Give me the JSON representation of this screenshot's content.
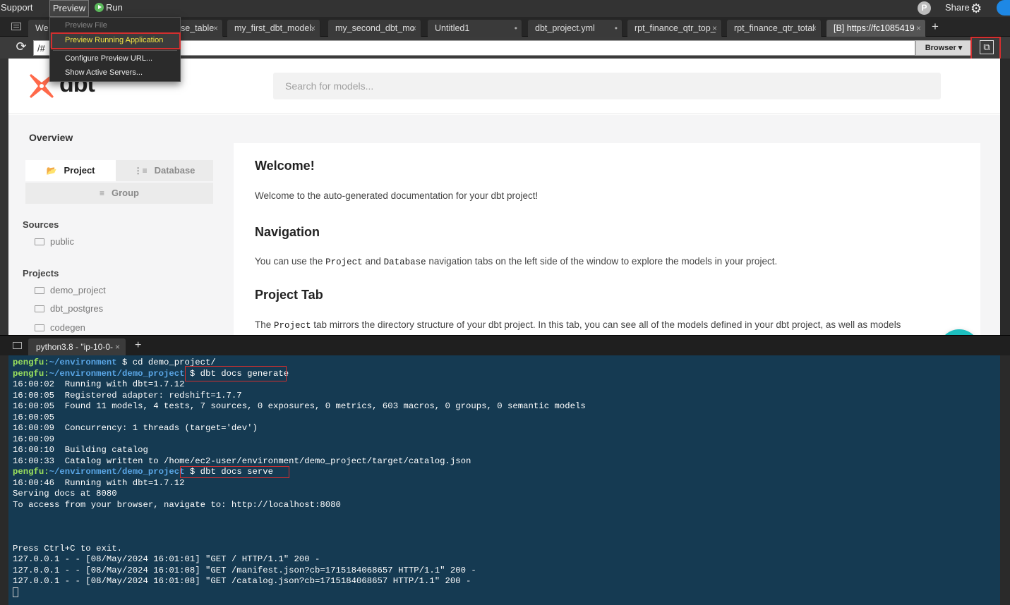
{
  "menubar": {
    "support": "Support",
    "preview": "Preview",
    "run": "Run",
    "avatar_letter": "P",
    "share": "Share"
  },
  "preview_menu": {
    "items": [
      {
        "label": "Preview File",
        "state": "disabled"
      },
      {
        "label": "Preview Running Application",
        "state": "selected"
      },
      {
        "label": "Configure Preview URL...",
        "state": "normal"
      },
      {
        "label": "Show Active Servers...",
        "state": "normal"
      }
    ]
  },
  "editor_tabs": [
    {
      "label": "We",
      "close": ""
    },
    {
      "label": "se_table",
      "close": "×"
    },
    {
      "label": "my_first_dbt_model.",
      "close": "×"
    },
    {
      "label": "my_second_dbt_mo",
      "close": "×"
    },
    {
      "label": "Untitled1",
      "close": "•"
    },
    {
      "label": "dbt_project.yml",
      "close": "•"
    },
    {
      "label": "rpt_finance_qtr_top_",
      "close": "×"
    },
    {
      "label": "rpt_finance_qtr_total",
      "close": "×"
    },
    {
      "label": "[B] https://fc1085419",
      "close": "×"
    }
  ],
  "addressbar": {
    "url_value": "/#",
    "browser_label": "Browser ▾"
  },
  "docs": {
    "logo_text": "dbt",
    "search_placeholder": "Search for models...",
    "overview": "Overview",
    "seg_project": "Project",
    "seg_database": "Database",
    "seg_group": "Group",
    "sources_heading": "Sources",
    "sources": [
      "public"
    ],
    "projects_heading": "Projects",
    "projects": [
      "demo_project",
      "dbt_postgres",
      "codegen"
    ],
    "welcome_title": "Welcome!",
    "welcome_text": "Welcome to the auto-generated documentation for your dbt project!",
    "nav_title": "Navigation",
    "nav_text_1": "You can use the ",
    "nav_code_1": "Project",
    "nav_text_2": " and ",
    "nav_code_2": "Database",
    "nav_text_3": " navigation tabs on the left side of the window to explore the models in your project.",
    "project_tab_title": "Project Tab",
    "pt_text_1": "The ",
    "pt_code": "Project",
    "pt_text_2": " tab mirrors the directory structure of your dbt project. In this tab, you can see all of the models defined in your dbt project, as well as models"
  },
  "terminal": {
    "tab_label": "python3.8 - \"ip-10-0-",
    "tab_close": "×",
    "lines": [
      {
        "user": "pengfu",
        "path": "~/environment",
        "cmd": " $ cd demo_project/"
      },
      {
        "user": "pengfu",
        "path": "~/environment/demo_project",
        "cmd": " $ dbt docs generate"
      },
      {
        "text": "16:00:02  Running with dbt=1.7.12"
      },
      {
        "text": "16:00:05  Registered adapter: redshift=1.7.7"
      },
      {
        "text": "16:00:05  Found 11 models, 4 tests, 7 sources, 0 exposures, 0 metrics, 603 macros, 0 groups, 0 semantic models"
      },
      {
        "text": "16:00:05"
      },
      {
        "text": "16:00:09  Concurrency: 1 threads (target='dev')"
      },
      {
        "text": "16:00:09"
      },
      {
        "text": "16:00:10  Building catalog"
      },
      {
        "text": "16:00:33  Catalog written to /home/ec2-user/environment/demo_project/target/catalog.json"
      },
      {
        "user": "pengfu",
        "path": "~/environment/demo_project",
        "cmd": " $ dbt docs serve"
      },
      {
        "text": "16:00:46  Running with dbt=1.7.12"
      },
      {
        "text": "Serving docs at 8080"
      },
      {
        "text": "To access from your browser, navigate to: http://localhost:8080"
      },
      {
        "text": ""
      },
      {
        "text": ""
      },
      {
        "text": ""
      },
      {
        "text": "Press Ctrl+C to exit."
      },
      {
        "text": "127.0.0.1 - - [08/May/2024 16:01:01] \"GET / HTTP/1.1\" 200 -"
      },
      {
        "text": "127.0.0.1 - - [08/May/2024 16:01:08] \"GET /manifest.json?cb=1715184068657 HTTP/1.1\" 200 -"
      },
      {
        "text": "127.0.0.1 - - [08/May/2024 16:01:08] \"GET /catalog.json?cb=1715184068657 HTTP/1.1\" 200 -"
      }
    ]
  },
  "colors": {
    "accent_teal": "#1dbfbf",
    "dbt_orange": "#ff694a",
    "highlight_red": "#d32f2f",
    "terminal_bg": "#153a52",
    "prompt_user": "#9be15d",
    "prompt_path": "#5aa6e6"
  }
}
